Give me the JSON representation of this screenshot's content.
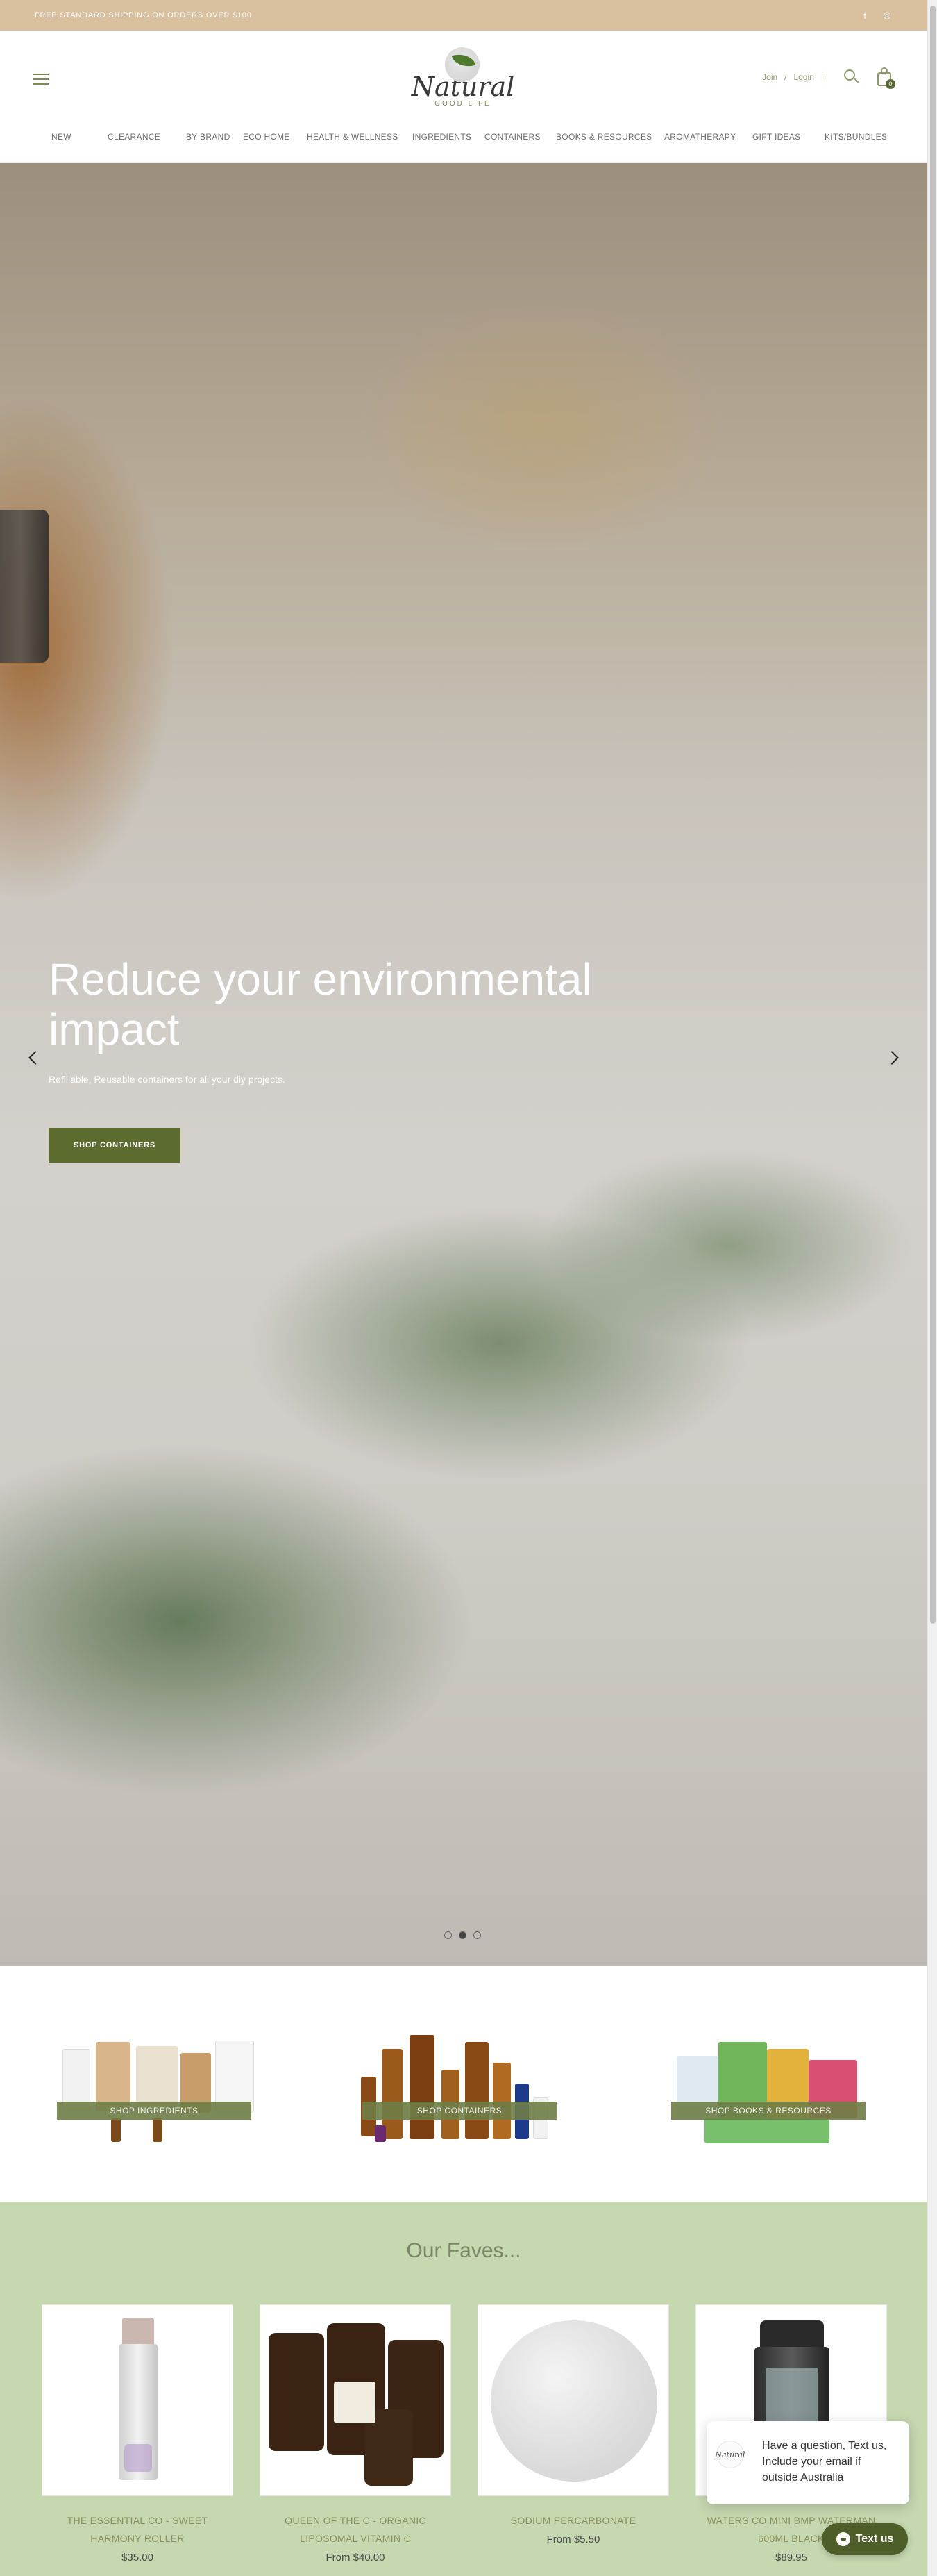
{
  "announcement": {
    "text": "FREE STANDARD SHIPPING ON ORDERS OVER $100"
  },
  "social": {
    "facebook": "f",
    "instagram": "◎"
  },
  "header": {
    "logo_word": "Natural",
    "logo_sub": "GOOD LIFE",
    "join": "Join",
    "separator": "/",
    "login": "Login",
    "separator2": "|",
    "cart_count": "0"
  },
  "nav": [
    "NEW",
    "CLEARANCE",
    "BY BRAND",
    "ECO HOME",
    "HEALTH & WELLNESS",
    "INGREDIENTS",
    "CONTAINERS",
    "BOOKS & RESOURCES",
    "AROMATHERAPY",
    "GIFT IDEAS",
    "KITS/BUNDLES"
  ],
  "hero": {
    "title": "Reduce your environmental impact",
    "text": "Refillable, Reusable containers for all your diy projects.",
    "button": "SHOP CONTAINERS",
    "active_slide": 2
  },
  "categories": [
    "SHOP INGREDIENTS",
    "SHOP CONTAINERS",
    "SHOP BOOKS & RESOURCES"
  ],
  "faves": {
    "title": "Our Faves...",
    "products": [
      {
        "name": "THE ESSENTIAL CO - SWEET HARMONY ROLLER",
        "price": "$35.00"
      },
      {
        "name": "QUEEN OF THE C - ORGANIC LIPOSOMAL VITAMIN C",
        "price": "From $40.00"
      },
      {
        "name": "SODIUM PERCARBONATE",
        "price": "From $5.50"
      },
      {
        "name": "WATERS CO MINI BMP WATERMAN 600ML BLACK",
        "price": "$89.95"
      }
    ]
  },
  "chat": {
    "avatar_text": "Natural",
    "popup": "Have a question, Text us, Include your email if outside Australia",
    "button": "Text us"
  },
  "colors": {
    "accent": "#5c6b2e",
    "topbar": "#d9c19f",
    "faves_bg": "#c5d8b0"
  }
}
